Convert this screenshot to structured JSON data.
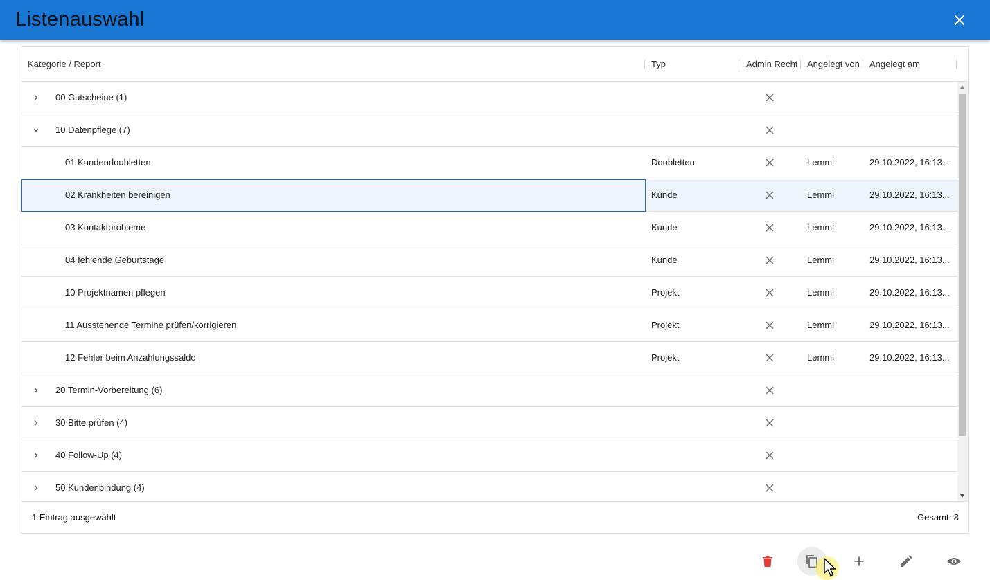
{
  "dialog": {
    "title": "Listenauswahl"
  },
  "columns": {
    "name": "Kategorie / Report",
    "type": "Typ",
    "admin": "Admin Recht",
    "created_by": "Angelegt von",
    "created_at": "Angelegt am"
  },
  "rows": [
    {
      "name": "00 Gutscheine (1)",
      "kind": "group",
      "expanded": false,
      "type": "",
      "created_by": "",
      "created_at": ""
    },
    {
      "name": "10 Datenpflege (7)",
      "kind": "group",
      "expanded": true,
      "type": "",
      "created_by": "",
      "created_at": ""
    },
    {
      "name": "01 Kundendoubletten",
      "kind": "item",
      "type": "Doubletten",
      "created_by": "Lemmi",
      "created_at": "29.10.2022, 16:13..."
    },
    {
      "name": "02 Krankheiten bereinigen",
      "kind": "item",
      "selected": true,
      "type": "Kunde",
      "created_by": "Lemmi",
      "created_at": "29.10.2022, 16:13..."
    },
    {
      "name": "03 Kontaktprobleme",
      "kind": "item",
      "type": "Kunde",
      "created_by": "Lemmi",
      "created_at": "29.10.2022, 16:13..."
    },
    {
      "name": "04 fehlende Geburtstage",
      "kind": "item",
      "type": "Kunde",
      "created_by": "Lemmi",
      "created_at": "29.10.2022, 16:13..."
    },
    {
      "name": "10 Projektnamen pflegen",
      "kind": "item",
      "type": "Projekt",
      "created_by": "Lemmi",
      "created_at": "29.10.2022, 16:13..."
    },
    {
      "name": "11 Ausstehende Termine prüfen/korrigieren",
      "kind": "item",
      "type": "Projekt",
      "created_by": "Lemmi",
      "created_at": "29.10.2022, 16:13..."
    },
    {
      "name": "12 Fehler beim Anzahlungssaldo",
      "kind": "item",
      "type": "Projekt",
      "created_by": "Lemmi",
      "created_at": "29.10.2022, 16:13..."
    },
    {
      "name": "20 Termin-Vorbereitung (6)",
      "kind": "group",
      "expanded": false,
      "type": "",
      "created_by": "",
      "created_at": ""
    },
    {
      "name": "30 Bitte prüfen (4)",
      "kind": "group",
      "expanded": false,
      "type": "",
      "created_by": "",
      "created_at": ""
    },
    {
      "name": "40 Follow-Up (4)",
      "kind": "group",
      "expanded": false,
      "type": "",
      "created_by": "",
      "created_at": ""
    },
    {
      "name": "50 Kundenbindung (4)",
      "kind": "group",
      "expanded": false,
      "type": "",
      "created_by": "",
      "created_at": ""
    }
  ],
  "footer": {
    "selection": "1 Eintrag ausgewählt",
    "total": "Gesamt: 8"
  },
  "actions": [
    {
      "name": "delete-button",
      "icon": "trash-icon",
      "color": "#e53935"
    },
    {
      "name": "copy-button",
      "icon": "copy-icon",
      "color": "#6b6b6b"
    },
    {
      "name": "add-button",
      "icon": "plus-icon",
      "color": "#6b6b6b"
    },
    {
      "name": "edit-button",
      "icon": "pencil-icon",
      "color": "#6b6b6b"
    },
    {
      "name": "view-button",
      "icon": "eye-icon",
      "color": "#6b6b6b"
    }
  ],
  "colors": {
    "titlebar": "#1976d2",
    "selected_row": "#eef4fb",
    "focus_border": "#1e6fbf"
  }
}
